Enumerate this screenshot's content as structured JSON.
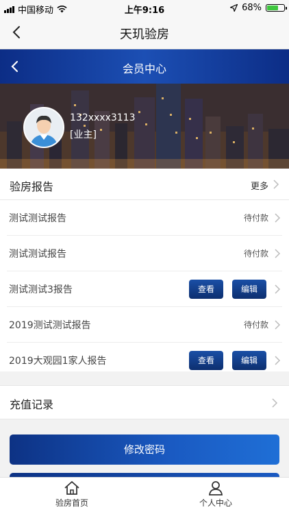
{
  "status_bar": {
    "carrier": "中国移动",
    "time": "上午9:16",
    "battery": "68%",
    "battery_level": 0.68
  },
  "nav": {
    "title": "天玑验房"
  },
  "hero": {
    "title": "会员中心",
    "phone": "132xxxx3113",
    "role": "[业主]"
  },
  "reports": {
    "header": "验房报告",
    "more": "更多",
    "items": [
      {
        "title": "测试测试报告",
        "status": "待付款"
      },
      {
        "title": "测试测试报告",
        "status": "待付款"
      },
      {
        "title": "测试测试3报告",
        "view": "查看",
        "edit": "编辑"
      },
      {
        "title": "2019测试测试报告",
        "status": "待付款"
      },
      {
        "title": "2019大观园1家人报告",
        "view": "查看",
        "edit": "编辑"
      }
    ]
  },
  "recharge": {
    "label": "充值记录"
  },
  "change_password": {
    "label": "修改密码"
  },
  "tabs": [
    {
      "label": "验房首页",
      "icon": "home-icon"
    },
    {
      "label": "个人中心",
      "icon": "person-icon"
    }
  ]
}
